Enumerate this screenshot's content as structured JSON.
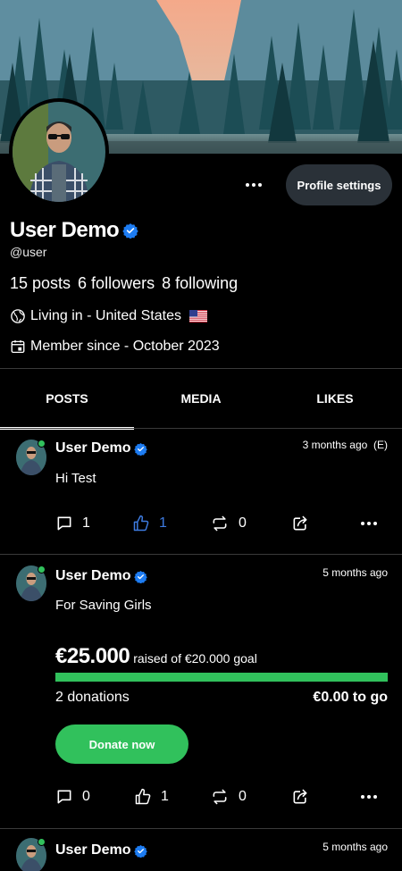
{
  "profile": {
    "name": "User Demo",
    "handle": "@user",
    "more_label": "More options",
    "settings_label": "Profile settings",
    "stats": {
      "posts": "15 posts",
      "followers": "6 followers",
      "following": "8 following"
    },
    "location": "Living in - United States",
    "member_since": "Member since - October 2023"
  },
  "tabs": [
    {
      "label": "POSTS",
      "active": true
    },
    {
      "label": "MEDIA",
      "active": false
    },
    {
      "label": "LIKES",
      "active": false
    }
  ],
  "posts": [
    {
      "author": "User Demo",
      "time": "3 months ago  (E)",
      "text": "Hi Test",
      "comments": "1",
      "likes": "1",
      "reposts": "0",
      "liked": true
    },
    {
      "author": "User Demo",
      "time": "5 months ago",
      "text": "For Saving Girls",
      "fundraiser": {
        "raised": "€25.000",
        "goal_text": "raised of €20.000 goal",
        "progress": 1.0,
        "donations": "2 donations",
        "to_go": "€0.00 to go",
        "button": "Donate now"
      },
      "comments": "0",
      "likes": "1",
      "reposts": "0",
      "liked": false
    },
    {
      "author": "User Demo",
      "time": "5 months ago"
    }
  ],
  "colors": {
    "background": "#000000",
    "accent_green": "#31c15c",
    "verified_blue": "#1d7cf2",
    "liked_blue": "#3d7be0",
    "button_dark": "#2a3138"
  },
  "icons": {
    "more": "more-horizontal-icon",
    "verified": "verified-badge-icon",
    "globe": "globe-icon",
    "calendar": "calendar-icon",
    "flag": "us-flag-icon",
    "comment": "comment-icon",
    "like": "thumbs-up-icon",
    "repost": "repost-icon",
    "share": "share-icon"
  }
}
